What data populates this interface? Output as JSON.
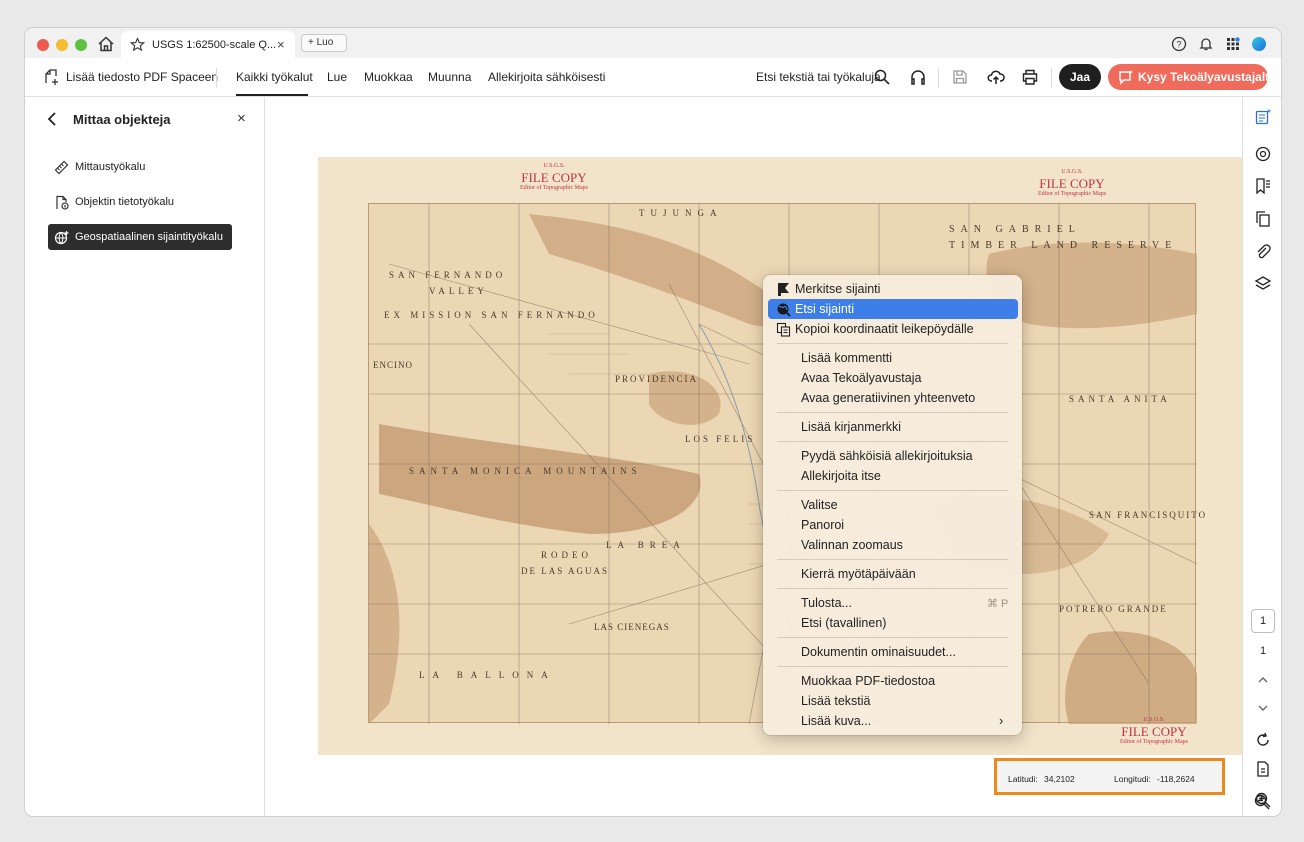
{
  "tab": {
    "title": "USGS 1:62500-scale Q...",
    "close": "×",
    "new_tab_label": "+  Luo"
  },
  "toolbar": {
    "add_file": "Lisää tiedosto PDF Spaceen",
    "nav": [
      "Kaikki työkalut",
      "Lue",
      "Muokkaa",
      "Muunna",
      "Allekirjoita sähköisesti"
    ],
    "search": "Etsi tekstiä tai työkaluja",
    "share": "Jaa",
    "ai_assistant": "Kysy Tekoälyavustajalta"
  },
  "left_panel": {
    "title": "Mittaa objekteja",
    "close": "×",
    "items": [
      {
        "label": "Mittaustyökalu",
        "icon": "ruler-icon"
      },
      {
        "label": "Objektin tietotyökalu",
        "icon": "object-info-icon"
      },
      {
        "label": "Geospatiaalinen sijaintityökalu",
        "icon": "geo-location-icon",
        "selected": true
      }
    ]
  },
  "map": {
    "stamps": [
      {
        "title": "U.S.G.S.",
        "main": "FILE COPY",
        "sub": "Editor of Topographic Maps"
      },
      {
        "title": "U.S.G.S.",
        "main": "FILE COPY",
        "sub": "Editor of Topographic Maps"
      },
      {
        "title": "U.S.G.S.",
        "main": "FILE COPY",
        "sub": "Editor of Topographic Maps"
      }
    ],
    "labels": [
      "SAN GABRIEL",
      "TIMBER LAND RESERVE",
      "SAN FERNANDO",
      "VALLEY",
      "EX MISSION SAN FERNANDO",
      "ENCINO",
      "PROVIDENCIA",
      "SANTA MONICA MOUNTAINS",
      "RODEO",
      "LA BREA",
      "DE LAS AGUAS",
      "LA BALLONA",
      "LOS FELIS",
      "SANTA ANITA",
      "SAN FRANCISQUITO",
      "POTRERO GRANDE",
      "LAS CIENEGAS",
      "TUJUNGA"
    ]
  },
  "context_menu": {
    "groups": [
      [
        "Merkitse sijainti",
        "Etsi sijainti",
        "Kopioi koordinaatit leikepöydälle"
      ],
      [
        "Lisää kommentti",
        "Avaa Tekoälyavustaja",
        "Avaa generatiivinen yhteenveto"
      ],
      [
        "Lisää kirjanmerkki"
      ],
      [
        "Pyydä sähköisiä allekirjoituksia",
        "Allekirjoita itse"
      ],
      [
        "Valitse",
        "Panoroi",
        "Valinnan zoomaus"
      ],
      [
        "Kierrä myötäpäivään"
      ],
      [
        "Tulosta...",
        "Etsi (tavallinen)"
      ],
      [
        "Dokumentin ominaisuudet..."
      ],
      [
        "Muokkaa PDF-tiedostoa",
        "Lisää tekstiä",
        "Lisää kuva..."
      ]
    ],
    "highlighted": "Etsi sijainti",
    "print_shortcut": "⌘ P",
    "submenu_arrow": "›"
  },
  "coordinates": {
    "lat_label": "Latitudi:",
    "lat_value": "34,2102",
    "lon_label": "Longitudi:",
    "lon_value": "-118,2624"
  },
  "page_nav": {
    "current": "1",
    "total": "1"
  },
  "colors": {
    "accent_highlight": "#3d7ee8",
    "ai_button": "#f06b5b",
    "coords_border": "#ee8a1c",
    "stamp": "#c0334a"
  }
}
